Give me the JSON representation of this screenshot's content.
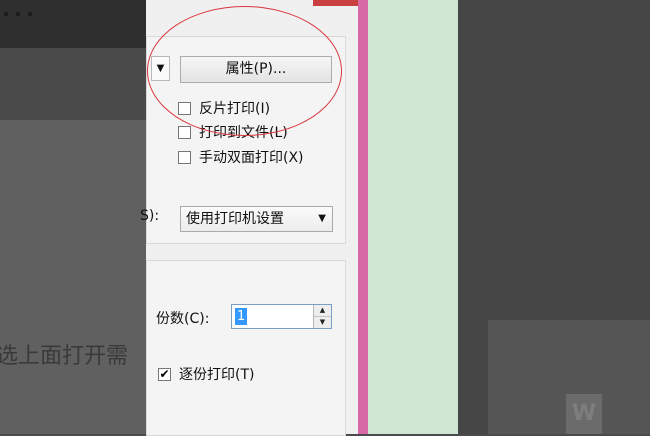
{
  "background": {
    "top_fragment": "…",
    "doc_text": "选上面打开需"
  },
  "dialog": {
    "properties_button": "属性(P)...",
    "checkboxes": [
      {
        "label": "反片打印(I)",
        "checked": false
      },
      {
        "label": "打印到文件(L)",
        "checked": false
      },
      {
        "label": "手动双面打印(X)",
        "checked": false
      }
    ],
    "paper_source_label_fragment": "S):",
    "paper_source_value": "使用打印机设置",
    "copies_label": "份数(C):",
    "copies_value": "1",
    "collate_label": "逐份打印(T)",
    "collate_checked": true
  },
  "icons": {
    "word": "W"
  },
  "colors": {
    "window_border": "#d76aa6",
    "annotation_circle": "#d9363e",
    "side_panel": "#cfe7d2"
  }
}
